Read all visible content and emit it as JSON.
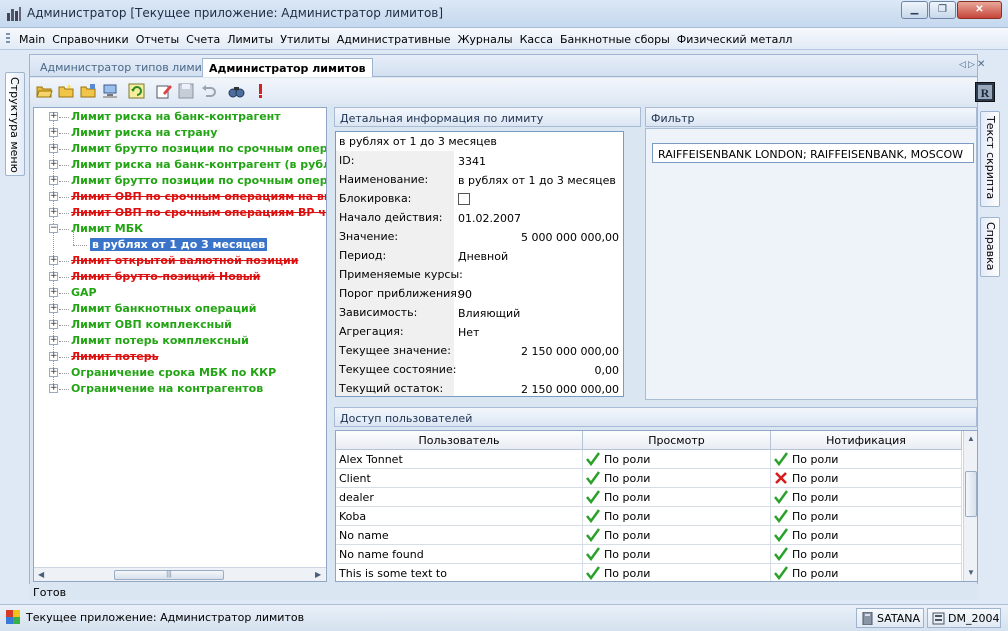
{
  "window": {
    "title": "Администратор [Текущее приложение: Администратор лимитов]"
  },
  "menu": [
    "Main",
    "Справочники",
    "Отчеты",
    "Счета",
    "Лимиты",
    "Утилиты",
    "Административные",
    "Журналы",
    "Касса",
    "Банкнотные сборы",
    "Физический металл"
  ],
  "left_tab": "Структура меню",
  "right_tabs": [
    "Текст скрипта",
    "Справка"
  ],
  "tabs": [
    {
      "label": "Администратор типов лимитов",
      "active": false
    },
    {
      "label": "Администратор лимитов",
      "active": true
    }
  ],
  "tree": [
    {
      "label": "Лимит риска на банк-контрагент",
      "style": "green"
    },
    {
      "label": "Лимит риска на страну",
      "style": "green"
    },
    {
      "label": "Лимит брутто позиции по срочным операци",
      "style": "green"
    },
    {
      "label": "Лимит риска на банк-контрагент (в рублях)",
      "style": "green"
    },
    {
      "label": "Лимит брутто позиции по срочным операци",
      "style": "green"
    },
    {
      "label": "Лимит ОВП по срочным операциям на внут",
      "style": "red"
    },
    {
      "label": "Лимит ОВП по срочным операциям ВР чист",
      "style": "red"
    },
    {
      "label": "Лимит МБК",
      "style": "green",
      "expanded": true
    },
    {
      "label": "в рублях от 1 до 3 месяцев",
      "style": "selected",
      "child": true
    },
    {
      "label": "Лимит открытой валютной позиции",
      "style": "red"
    },
    {
      "label": "Лимит брутто-позиций Новый",
      "style": "red"
    },
    {
      "label": "GAP",
      "style": "green"
    },
    {
      "label": "Лимит банкнотных операций",
      "style": "green"
    },
    {
      "label": "Лимит ОВП комплексный",
      "style": "green"
    },
    {
      "label": "Лимит потерь комплексный",
      "style": "green"
    },
    {
      "label": "Лимит потерь",
      "style": "red"
    },
    {
      "label": "Ограничение срока МБК по ККР",
      "style": "green"
    },
    {
      "label": "Ограничение на контрагентов",
      "style": "green"
    }
  ],
  "detail": {
    "title": "Детальная информация по лимиту",
    "name_header": "в рублях от 1 до 3 месяцев",
    "rows": [
      {
        "label": "ID:",
        "value": "3341"
      },
      {
        "label": "Наименование:",
        "value": "в рублях от 1 до 3 месяцев"
      },
      {
        "label": "Блокировка:",
        "value": "",
        "checkbox": true
      },
      {
        "label": "Начало действия:",
        "value": "01.02.2007"
      },
      {
        "label": "Значение:",
        "value": "5 000 000 000,00",
        "num": true
      },
      {
        "label": "Период:",
        "value": "Дневной"
      },
      {
        "label": "Применяемые курсы:",
        "value": ""
      },
      {
        "label": "Порог приближения:",
        "value": "90"
      },
      {
        "label": "Зависимость:",
        "value": "Влияющий"
      },
      {
        "label": "Агрегация:",
        "value": "Нет"
      },
      {
        "label": "Текущее значение:",
        "value": "2 150 000 000,00",
        "num": true
      },
      {
        "label": "Текущее состояние:",
        "value": "0,00",
        "num": true
      },
      {
        "label": "Текущий остаток:",
        "value": "2 150 000 000,00",
        "num": true
      }
    ]
  },
  "filter": {
    "title": "Фильтр",
    "value": "RAIFFEISENBANK LONDON; RAIFFEISENBANK, MOSCOW"
  },
  "access": {
    "title": "Доступ пользователей",
    "columns": [
      "Пользователь",
      "Просмотр",
      "Нотификация"
    ],
    "rows": [
      {
        "user": "Alex Tonnet",
        "view": "По роли",
        "view_ok": true,
        "notify": "По роли",
        "notify_ok": true
      },
      {
        "user": "Client",
        "view": "По роли",
        "view_ok": true,
        "notify": "По роли",
        "notify_ok": false
      },
      {
        "user": "dealer",
        "view": "По роли",
        "view_ok": true,
        "notify": "По роли",
        "notify_ok": true
      },
      {
        "user": "Koba",
        "view": "По роли",
        "view_ok": true,
        "notify": "По роли",
        "notify_ok": true
      },
      {
        "user": "No name",
        "view": "По роли",
        "view_ok": true,
        "notify": "По роли",
        "notify_ok": true
      },
      {
        "user": "No name found",
        "view": "По роли",
        "view_ok": true,
        "notify": "По роли",
        "notify_ok": true
      },
      {
        "user": "This is some text to",
        "view": "По роли",
        "view_ok": true,
        "notify": "По роли",
        "notify_ok": true
      }
    ]
  },
  "status_ready": "Готов",
  "statusbar": {
    "current_app": "Текущее приложение: Администратор лимитов",
    "server": "SATANA",
    "database": "DM_2004"
  },
  "colors": {
    "active_green": "#22a414",
    "inactive_red": "#dd1010",
    "selection": "#3a74c9"
  }
}
